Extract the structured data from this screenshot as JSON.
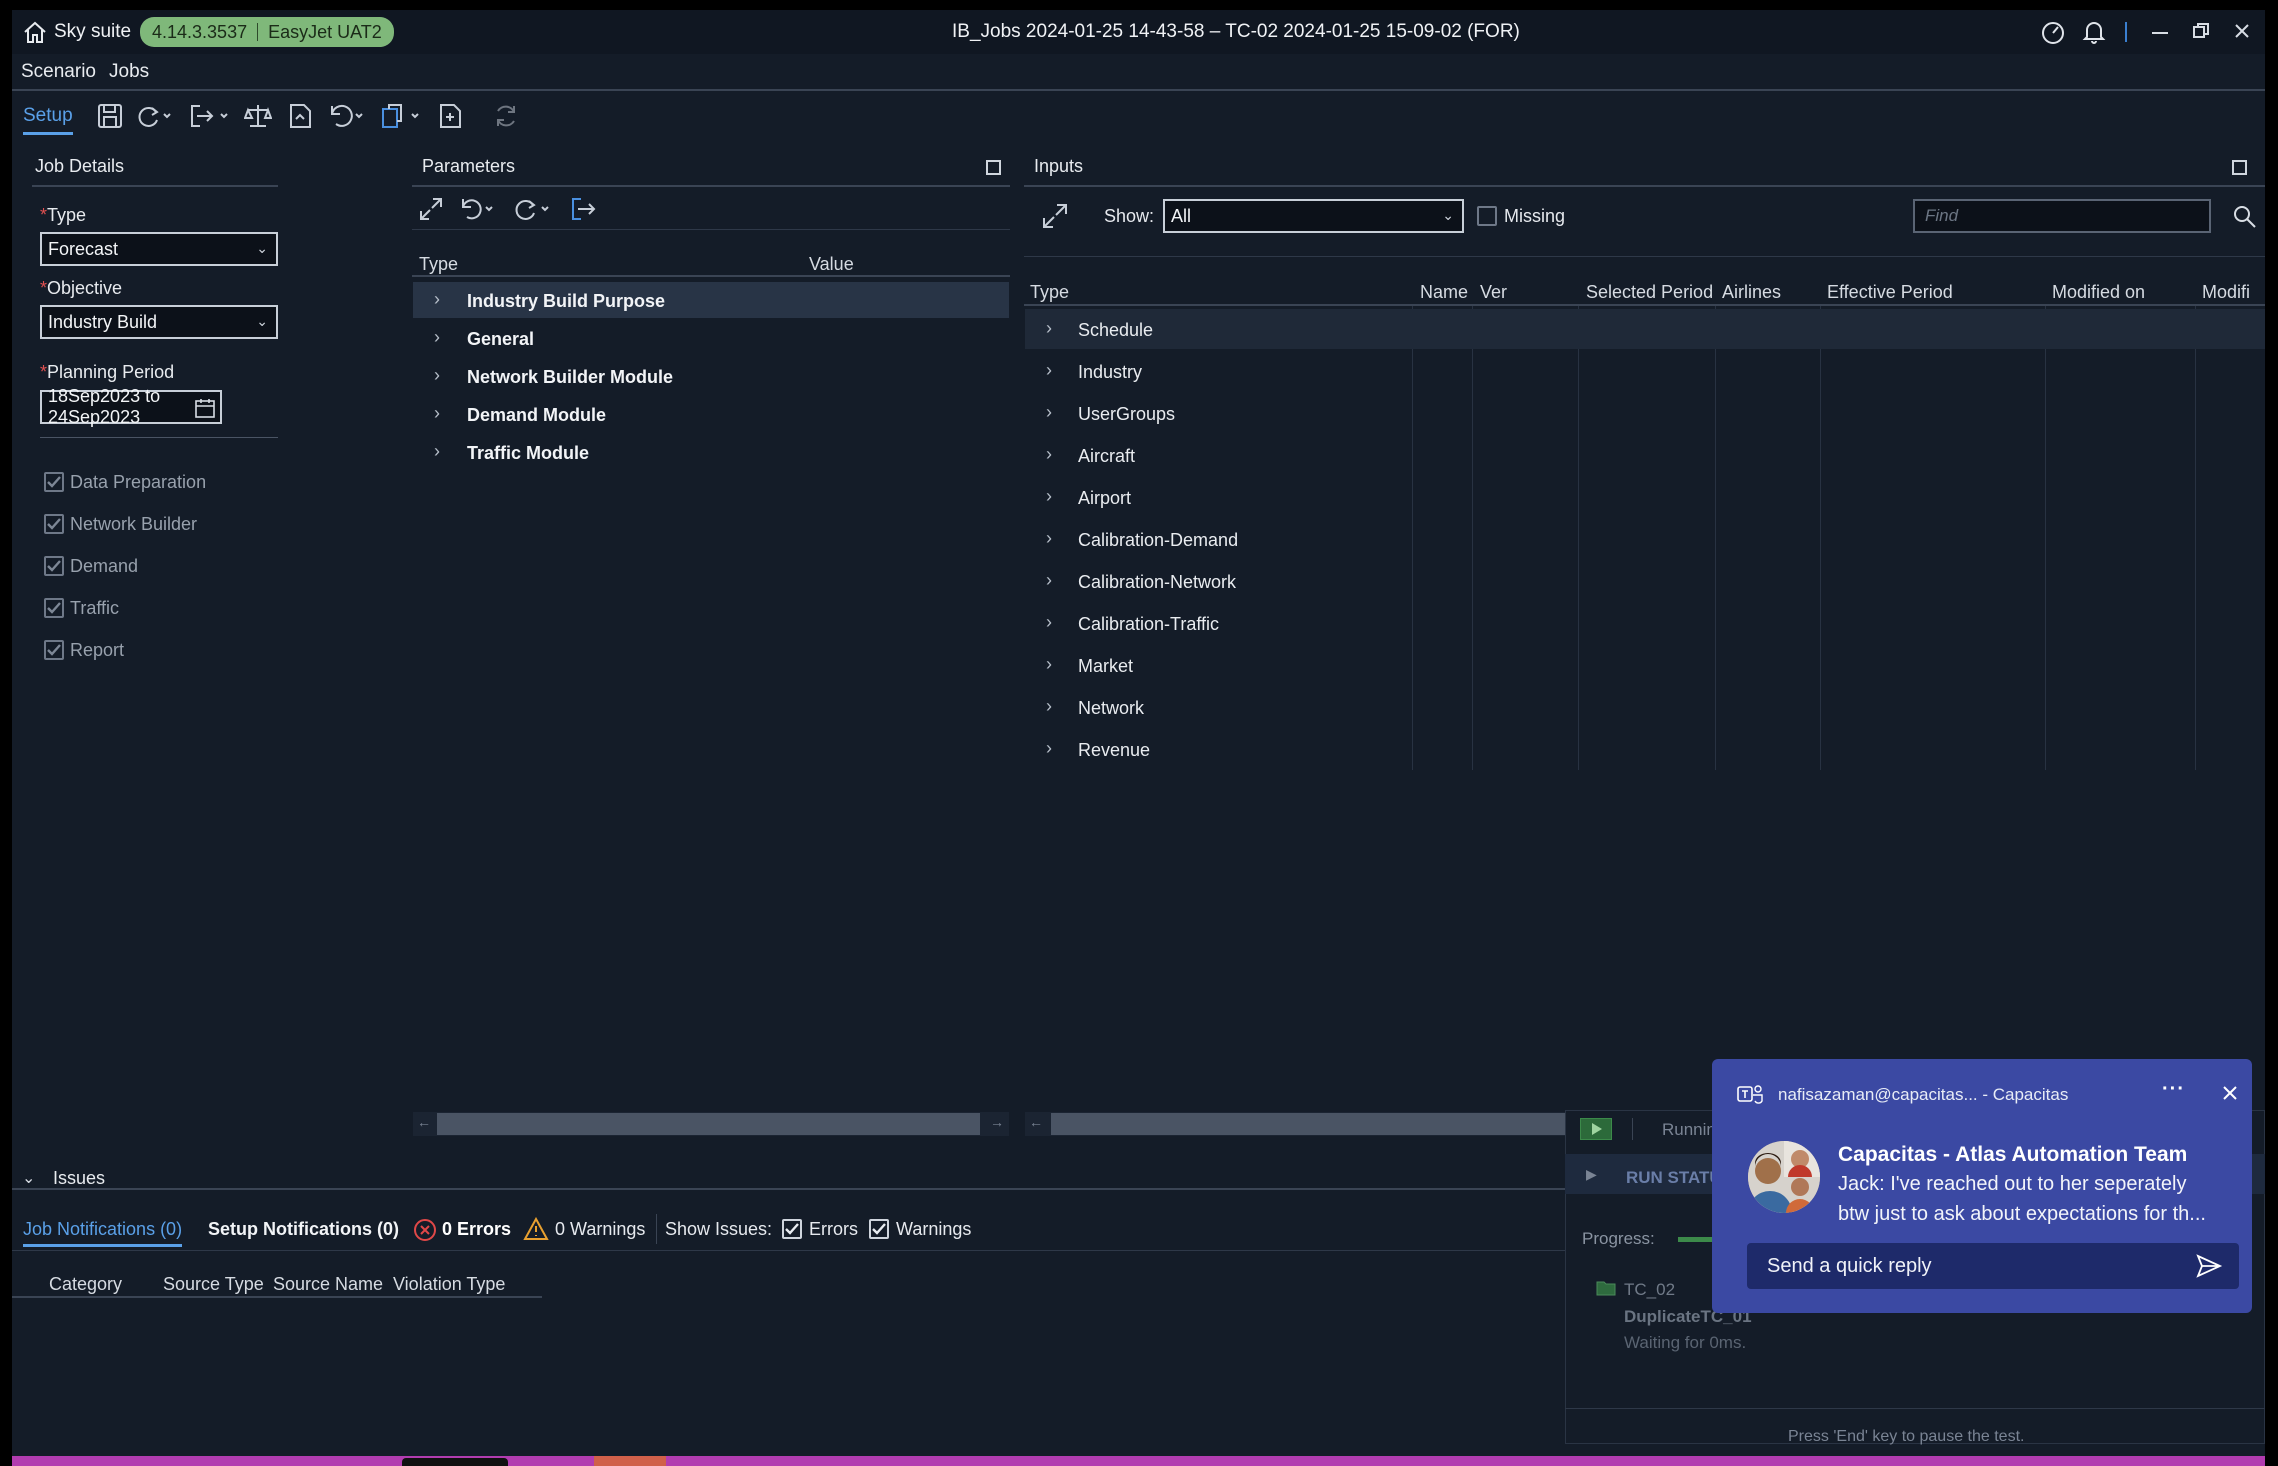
{
  "window": {
    "app_name": "Sky suite",
    "version": "4.14.3.3537",
    "environment": "EasyJet UAT2",
    "title": "IB_Jobs 2024-01-25 14-43-58 – TC-02 2024-01-25 15-09-02 (FOR)"
  },
  "menu": {
    "items": [
      "Scenario",
      "Jobs"
    ]
  },
  "toolbar": {
    "setup_label": "Setup"
  },
  "job_details": {
    "title": "Job Details",
    "type_label": "Type",
    "type_value": "Forecast",
    "objective_label": "Objective",
    "objective_value": "Industry Build",
    "period_label": "Planning Period",
    "period_value": "18Sep2023 to 24Sep2023",
    "steps": [
      {
        "label": "Data Preparation",
        "checked": true
      },
      {
        "label": "Network Builder",
        "checked": true
      },
      {
        "label": "Demand",
        "checked": true
      },
      {
        "label": "Traffic",
        "checked": true
      },
      {
        "label": "Report",
        "checked": true
      }
    ]
  },
  "parameters": {
    "title": "Parameters",
    "col_type": "Type",
    "col_value": "Value",
    "rows": [
      "Industry Build Purpose",
      "General",
      "Network Builder Module",
      "Demand Module",
      "Traffic Module"
    ]
  },
  "inputs": {
    "title": "Inputs",
    "show_label": "Show:",
    "show_value": "All",
    "missing_label": "Missing",
    "find_placeholder": "Find",
    "columns": [
      "Type",
      "Name",
      "Ver",
      "Selected Period",
      "Airlines",
      "Effective Period",
      "Modified on",
      "Modifi"
    ],
    "rows": [
      "Schedule",
      "Industry",
      "UserGroups",
      "Aircraft",
      "Airport",
      "Calibration-Demand",
      "Calibration-Network",
      "Calibration-Traffic",
      "Market",
      "Network",
      "Revenue"
    ]
  },
  "issues": {
    "title": "Issues",
    "tab_job": "Job Notifications (0)",
    "tab_setup": "Setup Notifications (0)",
    "errors": "0 Errors",
    "warnings": "0 Warnings",
    "show_issues": "Show Issues:",
    "filter_errors": "Errors",
    "filter_warnings": "Warnings",
    "columns": [
      "Category",
      "Source Type",
      "Source Name",
      "Violation Type"
    ]
  },
  "runner": {
    "running": "Runnin",
    "run_status": "RUN STATU",
    "progress_label": "Progress:",
    "item_folder": "TC_02",
    "item_name": "DuplicateTC_01",
    "item_status": "Waiting for 0ms.",
    "footer": "Press 'End' key to pause the test."
  },
  "notification": {
    "account": "nafisazaman@capacitas... - Capacitas",
    "sender": "Capacitas - Atlas Automation Team",
    "message_line1": "Jack: I've reached out to her seperately",
    "message_line2": "btw just to ask about expectations for th...",
    "reply_placeholder": "Send a quick reply"
  },
  "colors": {
    "background": "#141c28",
    "accent": "#5aa0e8",
    "badge": "#7fb87a",
    "notification": "#3b49a3",
    "error": "#e04848",
    "warning": "#e8a030"
  }
}
